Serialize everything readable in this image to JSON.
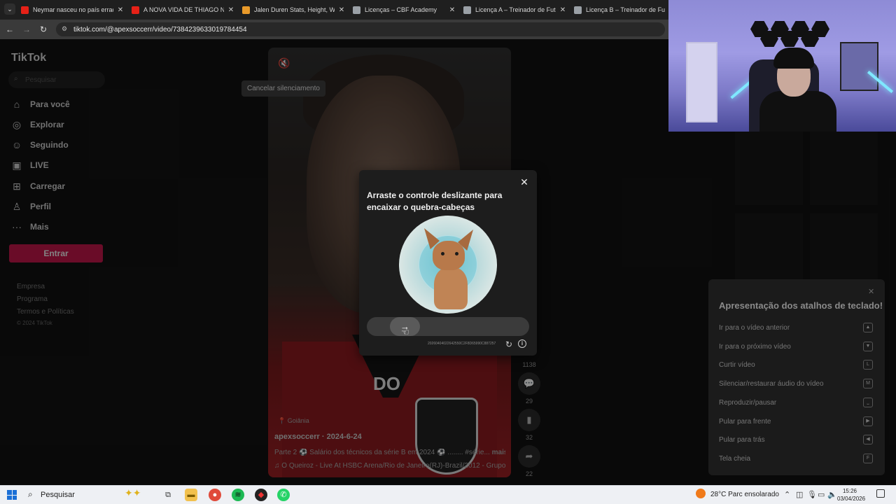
{
  "browser": {
    "tabs": [
      {
        "title": "Neymar nasceu no país errado",
        "favicon_color": "#e62117"
      },
      {
        "title": "A NOVA VIDA DE THIAGO NEVES",
        "favicon_color": "#e62117"
      },
      {
        "title": "Jalen Duren Stats, Height, Weight",
        "favicon_color": "#e89a2a"
      },
      {
        "title": "Licenças – CBF Academy",
        "favicon_color": "#9aa0a6"
      },
      {
        "title": "Licença A – Treinador de Futebol",
        "favicon_color": "#9aa0a6"
      },
      {
        "title": "Licença B – Treinador de Futebol",
        "favicon_color": "#9aa0a6"
      }
    ],
    "url": "tiktok.com/@apexsoccerr/video/7384239633019784454"
  },
  "tiktok": {
    "logo": "TikTok",
    "search_placeholder": "Pesquisar",
    "nav": [
      {
        "label": "Para você",
        "icon": "home-icon"
      },
      {
        "label": "Explorar",
        "icon": "compass-icon"
      },
      {
        "label": "Seguindo",
        "icon": "following-icon"
      },
      {
        "label": "LIVE",
        "icon": "live-icon"
      },
      {
        "label": "Carregar",
        "icon": "upload-icon"
      },
      {
        "label": "Perfil",
        "icon": "profile-icon"
      },
      {
        "label": "Mais",
        "icon": "more-icon"
      }
    ],
    "login_button": "Entrar",
    "footer_links": [
      "Empresa",
      "Programa",
      "Termos e Políticas"
    ],
    "copyright": "© 2024 TikTok",
    "unmute_tooltip": "Cancelar silenciamento",
    "video": {
      "overlay_text": "DO",
      "location": "Goiânia",
      "author": "apexsoccerr · 2024-6-24",
      "caption": "Parte 2 ⚽ Salário dos técnicos da série B em 2024 ⚽ ........ #série...",
      "caption_more": "mais",
      "music": "♫  Ô Queiroz - Live At HSBC Arena/Rio de Janeiro(RJ)-Brazil/2012 - Grupo",
      "counts": {
        "likes": "1138",
        "comments": "29",
        "saves": "32",
        "shares": "22"
      }
    },
    "shortcuts": {
      "title": "Apresentação dos atalhos de teclado!",
      "items": [
        {
          "label": "Ir para o vídeo anterior",
          "key": "▲"
        },
        {
          "label": "Ir para o próximo vídeo",
          "key": "▼"
        },
        {
          "label": "Curtir vídeo",
          "key": "L"
        },
        {
          "label": "Silenciar/restaurar áudio do vídeo",
          "key": "M"
        },
        {
          "label": "Reproduzir/pausar",
          "key": "⎵"
        },
        {
          "label": "Pular para frente",
          "key": "▶"
        },
        {
          "label": "Pular para trás",
          "key": "◀"
        },
        {
          "label": "Tela cheia",
          "key": "F"
        }
      ]
    }
  },
  "captcha": {
    "title": "Arraste o controle deslizante para encaixar o quebra-cabeças",
    "captcha_id": "20260404022642550C2F8D65990C887257",
    "slider_arrow": "→"
  },
  "taskbar": {
    "search": "Pesquisar",
    "weather": "28°C  Parc ensolarado",
    "time": "15:26",
    "date": "03/04/2026"
  }
}
